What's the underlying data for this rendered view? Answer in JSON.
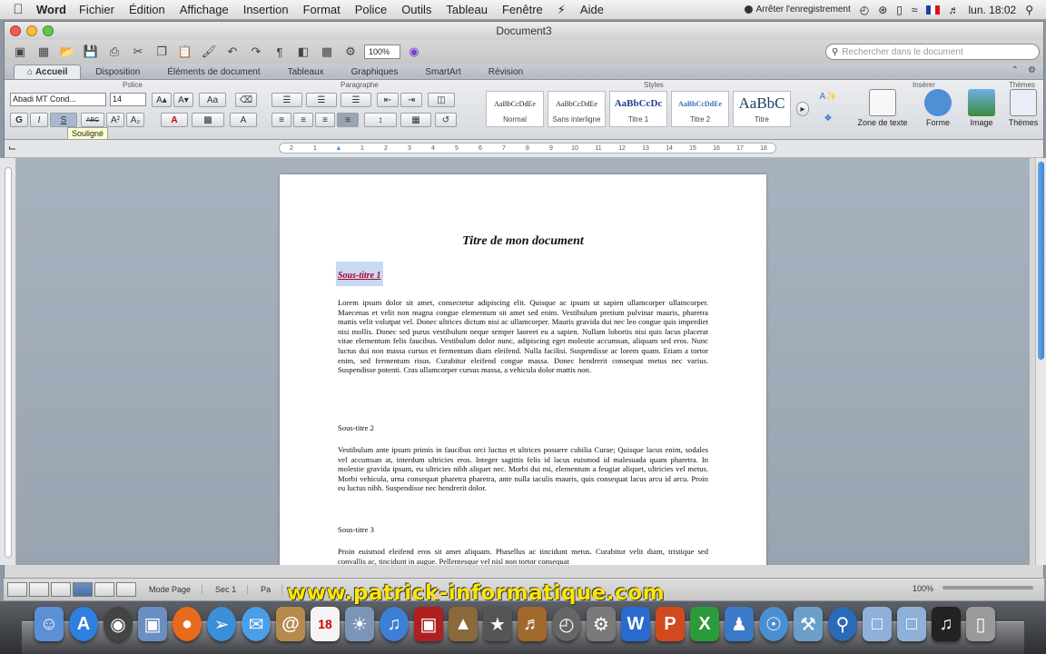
{
  "menubar": {
    "app": "Word",
    "items": [
      "Fichier",
      "Édition",
      "Affichage",
      "Insertion",
      "Format",
      "Police",
      "Outils",
      "Tableau",
      "Fenêtre",
      "Aide"
    ],
    "recording": "Arrêter l'enregistrement",
    "clock": "lun. 18:02"
  },
  "window": {
    "title": "Document3"
  },
  "toolbar": {
    "zoom": "100%",
    "search_placeholder": "Rechercher dans le document"
  },
  "ribbon": {
    "tabs": [
      "Accueil",
      "Disposition",
      "Éléments de document",
      "Tableaux",
      "Graphiques",
      "SmartArt",
      "Révision"
    ],
    "groups": {
      "police": "Police",
      "paragraphe": "Paragraphe",
      "styles": "Styles",
      "inserer": "Insérer",
      "themes": "Thèmes"
    },
    "font_name": "Abadi MT Cond...",
    "font_size": "14",
    "styles": [
      {
        "preview": "AaBbCcDdEe",
        "name": "Normal"
      },
      {
        "preview": "AaBbCcDdEe",
        "name": "Sans interligne"
      },
      {
        "preview": "AaBbCcDc",
        "name": "Titre 1"
      },
      {
        "preview": "AaBbCcDdEe",
        "name": "Titre 2"
      },
      {
        "preview": "AaBbC",
        "name": "Titre"
      }
    ],
    "insert": {
      "textbox": "Zone de texte",
      "shape": "Forme",
      "image": "Image",
      "themes": "Thèmes"
    },
    "bold": "G",
    "italic": "I",
    "underline": "S"
  },
  "tooltip": "Souligné",
  "ruler_ticks": [
    "2",
    "1",
    "",
    "1",
    "2",
    "3",
    "4",
    "5",
    "6",
    "7",
    "8",
    "9",
    "10",
    "11",
    "12",
    "13",
    "14",
    "15",
    "16",
    "17",
    "18"
  ],
  "document": {
    "title": "Titre de mon document",
    "sub1": "Sous-titre 1",
    "para1": "Lorem ipsum dolor sit amet, consectetur adipiscing elit. Quisque ac ipsum ut sapien ullamcorper ullamcorper. Maecenas et velit non magna congue elementum sit amet sed enim. Vestibulum pretium pulvinar mauris, pharetra mattis velit volutpat vel. Donec ultrices dictum nisi ac ullamcorper. Mauris gravida dui nec leo congue quis imperdiet nisi mollis. Donec sed purus vestibulum neque semper laoreet eu a sapien. Nullam lobortis nisi quis lacus placerat vitae elementum felis faucibus. Vestibulum dolor nunc, adipiscing eget molestie accumsan, aliquam sed eros. Nunc luctus dui non massa cursus et fermentum diam eleifend. Nulla facilisi. Suspendisse ac lorem quam. Etiam a tortor enim, sed fermentum risus. Curabitur eleifend congue massa. Donec hendrerit consequat metus nec varius. Suspendisse potenti. Cras ullamcorper cursus massa, a vehicula dolor mattis non.",
    "sub2": "Sous-titre 2",
    "para2": "Vestibulum ante ipsum primis in faucibus orci luctus et ultrices posuere cubilia Curae; Quisque lacus enim, sodales vel accumsan at, interdum ultricies eros. Integer sagittis felis id lacus euismod id malesuada quam pharetra. In molestie gravida ipsum, eu ultricies nibh aliquet nec. Morbi dui mi, elementum a feugiat aliquet, ultricies vel metus. Morbi vehicula, urna consequat pharetra pharetra, ante nulla iaculis mauris, quis consequat lacus arcu id arcu. Proin eu luctus nibh. Suspendisse nec hendrerit dolor.",
    "sub3": "Sous-titre 3",
    "para3": "Proin euismod eleifend eros sit amet aliquam. Phasellus ac tincidunt metus. Curabitur velit diam, tristique sed convallis ac, tincidunt in augue. Pellentesque vel nisl non tortor consequat"
  },
  "status": {
    "mode": "Mode Page",
    "sec_label": "Sec",
    "sec": "1",
    "page_label": "Pa",
    "zoom": "100%"
  },
  "watermark": "www.patrick-informatique.com",
  "colors": {
    "accent": "#3f86d6",
    "selection": "#c9d9f2",
    "subtitle": "#b0002a",
    "watermark": "#ffe600"
  }
}
